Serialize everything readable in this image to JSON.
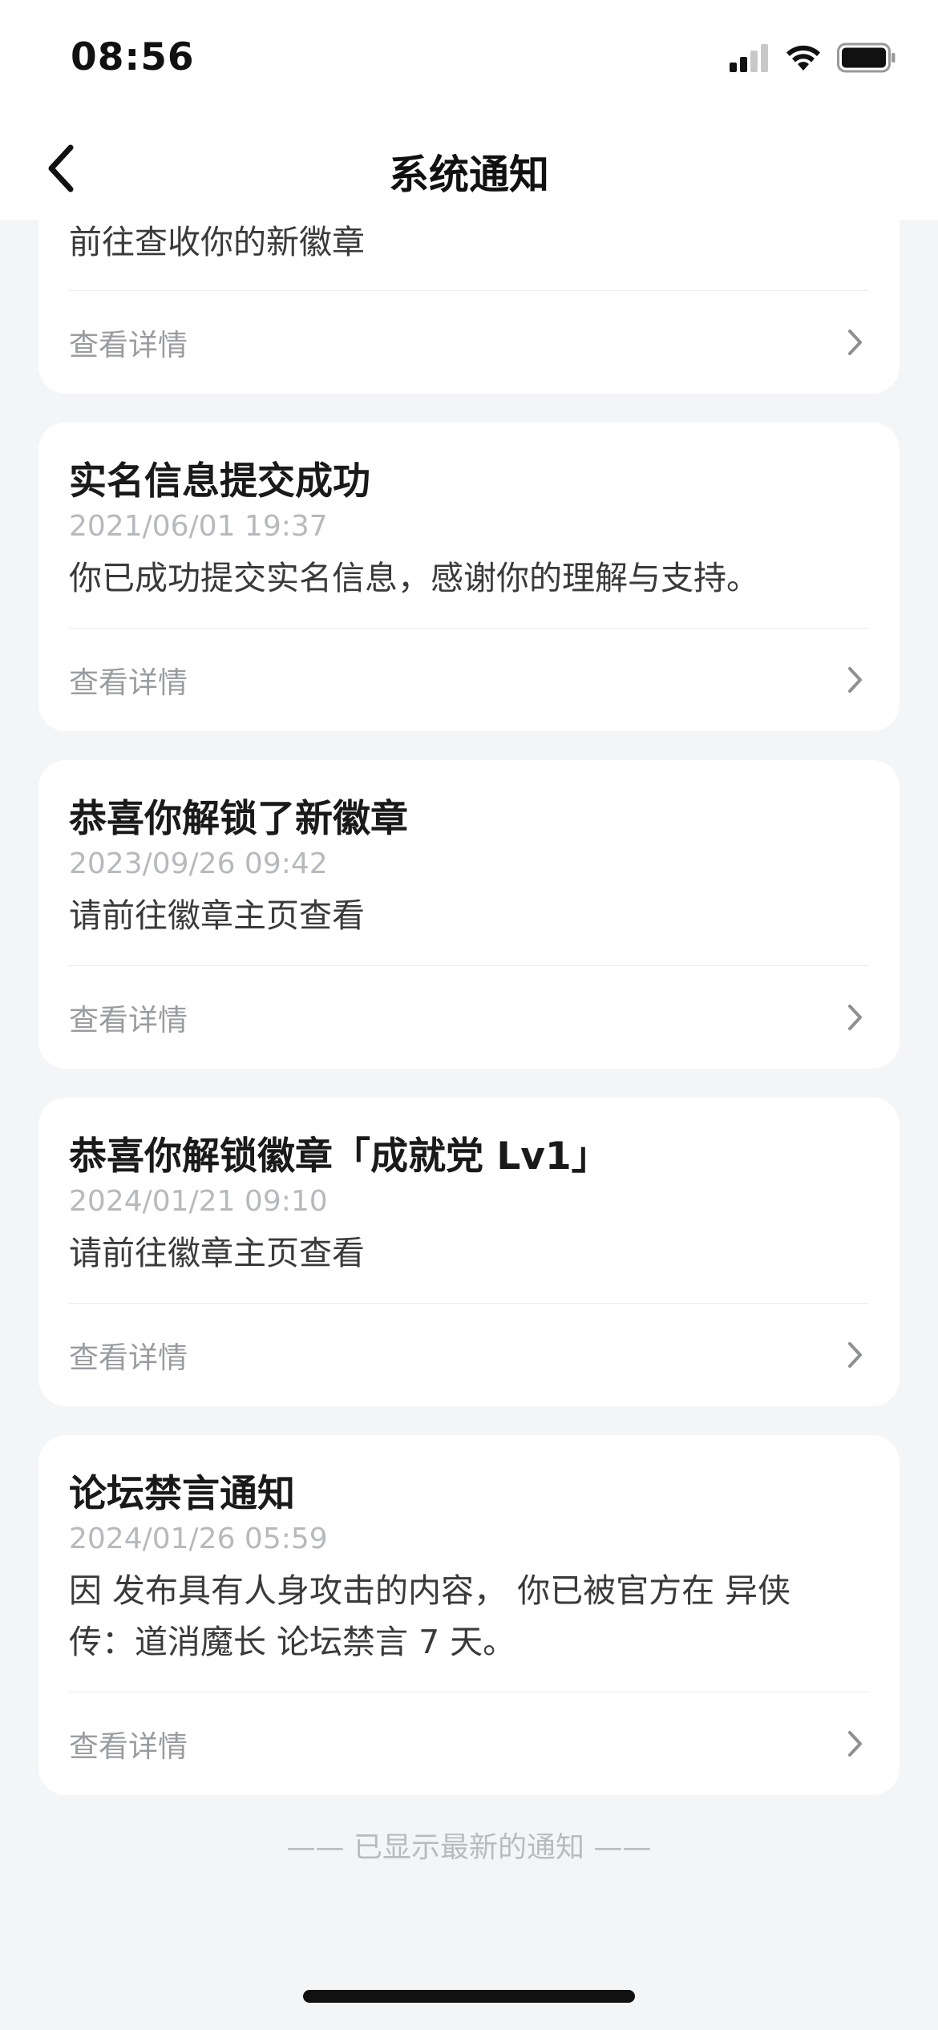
{
  "status_bar": {
    "time": "08:56",
    "icons": [
      "cellular-signal-icon",
      "wifi-icon",
      "battery-icon"
    ]
  },
  "nav": {
    "title": "系统通知",
    "back_icon": "chevron-left-icon"
  },
  "notifications": [
    {
      "title": "",
      "date": "",
      "body": "前往查收你的新徽章",
      "details_label": "查看详情"
    },
    {
      "title": "实名信息提交成功",
      "date": "2021/06/01 19:37",
      "body": "你已成功提交实名信息，感谢你的理解与支持。",
      "details_label": "查看详情"
    },
    {
      "title": "恭喜你解锁了新徽章",
      "date": "2023/09/26 09:42",
      "body": "请前往徽章主页查看",
      "details_label": "查看详情"
    },
    {
      "title": "恭喜你解锁徽章「成就党 Lv1」",
      "date": "2024/01/21 09:10",
      "body": "请前往徽章主页查看",
      "details_label": "查看详情"
    },
    {
      "title": "论坛禁言通知",
      "date": "2024/01/26 05:59",
      "body_line1": "因 发布具有人身攻击的内容， 你已被官方在 异侠",
      "body_line2": "传：道消魔长 论坛禁言 7 天。",
      "details_label": "查看详情"
    }
  ],
  "footer": {
    "note": "—— 已显示最新的通知 ——"
  },
  "colors": {
    "background": "#f4f5f7",
    "card": "#ffffff",
    "date_text": "#b7b9bd",
    "muted_text": "#9a9ca0"
  }
}
